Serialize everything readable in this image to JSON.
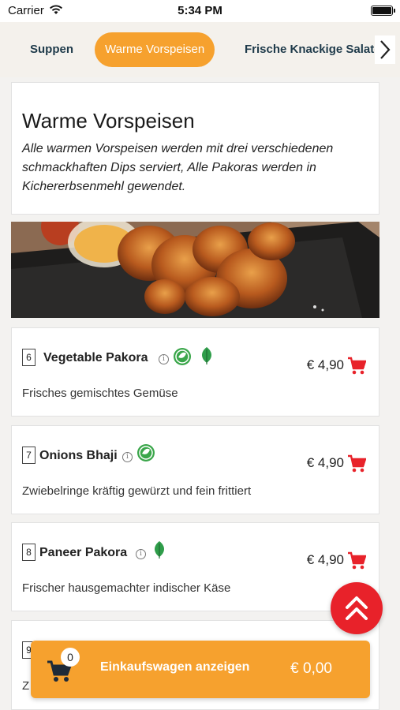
{
  "status_bar": {
    "carrier": "Carrier",
    "time": "5:34 PM"
  },
  "categories": [
    {
      "label": "Suppen",
      "active": false
    },
    {
      "label": "Warme Vorspeisen",
      "active": true
    },
    {
      "label": "Frische Knackige Salate",
      "active": false
    }
  ],
  "section": {
    "title": "Warme Vorspeisen",
    "description": "Alle warmen Vorspeisen werden mit drei verschiedenen schmackhaften Dips serviert, Alle Pakoras werden in Kichererbsenmehl gewendet."
  },
  "items": [
    {
      "number": "6",
      "name": "Vegetable Pakora",
      "description": "Frisches gemischtes Gemüse",
      "price": "€ 4,90",
      "badges": [
        "vegan",
        "vegetarian"
      ]
    },
    {
      "number": "7",
      "name": "Onions Bhaji",
      "description": "Zwiebelringe kräftig gewürzt und fein frittiert",
      "price": "€ 4,90",
      "badges": [
        "vegan"
      ]
    },
    {
      "number": "8",
      "name": "Paneer Pakora",
      "description": "Frischer hausgemachter indischer Käse",
      "price": "€ 4,90",
      "badges": [
        "vegetarian"
      ]
    },
    {
      "number": "9",
      "name": "",
      "description": "Z",
      "price": "",
      "badges": []
    }
  ],
  "cart": {
    "count": "0",
    "label": "Einkaufswagen anzeigen",
    "total": "€ 0,00"
  },
  "colors": {
    "accent": "#f6a12e",
    "fab": "#e8222a",
    "cart_icon": "#e8222a",
    "vegan_badge": "#3aa64a"
  }
}
